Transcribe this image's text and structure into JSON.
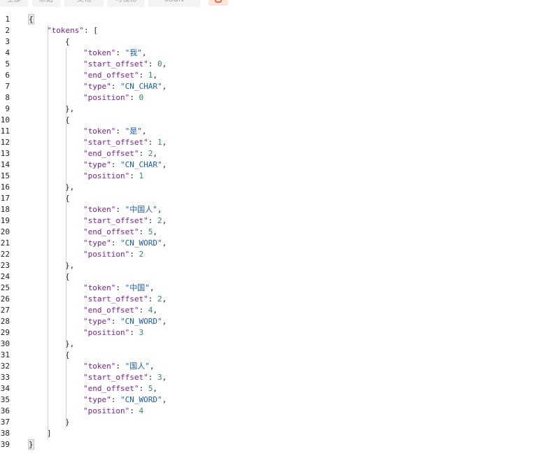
{
  "toolbar": {
    "items": [
      "全部",
      "原始",
      "美化",
      "可视化",
      "JSON"
    ],
    "icon": "share-icon"
  },
  "lines": [
    {
      "n": "1",
      "indent": 0,
      "parts": [
        [
          "p",
          "{"
        ]
      ]
    },
    {
      "n": "2",
      "indent": 1,
      "parts": [
        [
          "k",
          "\"tokens\""
        ],
        [
          "p",
          ": ["
        ]
      ]
    },
    {
      "n": "3",
      "indent": 2,
      "parts": [
        [
          "p",
          "{"
        ]
      ]
    },
    {
      "n": "4",
      "indent": 3,
      "parts": [
        [
          "k",
          "\"token\""
        ],
        [
          "p",
          ": "
        ],
        [
          "s",
          "\"我\""
        ],
        [
          "p",
          ","
        ]
      ]
    },
    {
      "n": "5",
      "indent": 3,
      "parts": [
        [
          "k",
          "\"start_offset\""
        ],
        [
          "p",
          ": "
        ],
        [
          "n",
          "0"
        ],
        [
          "p",
          ","
        ]
      ]
    },
    {
      "n": "6",
      "indent": 3,
      "parts": [
        [
          "k",
          "\"end_offset\""
        ],
        [
          "p",
          ": "
        ],
        [
          "n",
          "1"
        ],
        [
          "p",
          ","
        ]
      ]
    },
    {
      "n": "7",
      "indent": 3,
      "parts": [
        [
          "k",
          "\"type\""
        ],
        [
          "p",
          ": "
        ],
        [
          "s",
          "\"CN_CHAR\""
        ],
        [
          "p",
          ","
        ]
      ]
    },
    {
      "n": "8",
      "indent": 3,
      "parts": [
        [
          "k",
          "\"position\""
        ],
        [
          "p",
          ": "
        ],
        [
          "n",
          "0"
        ]
      ]
    },
    {
      "n": "9",
      "indent": 2,
      "parts": [
        [
          "p",
          "},"
        ]
      ]
    },
    {
      "n": "10",
      "indent": 2,
      "parts": [
        [
          "p",
          "{"
        ]
      ]
    },
    {
      "n": "11",
      "indent": 3,
      "parts": [
        [
          "k",
          "\"token\""
        ],
        [
          "p",
          ": "
        ],
        [
          "s",
          "\"是\""
        ],
        [
          "p",
          ","
        ]
      ]
    },
    {
      "n": "12",
      "indent": 3,
      "parts": [
        [
          "k",
          "\"start_offset\""
        ],
        [
          "p",
          ": "
        ],
        [
          "n",
          "1"
        ],
        [
          "p",
          ","
        ]
      ]
    },
    {
      "n": "13",
      "indent": 3,
      "parts": [
        [
          "k",
          "\"end_offset\""
        ],
        [
          "p",
          ": "
        ],
        [
          "n",
          "2"
        ],
        [
          "p",
          ","
        ]
      ]
    },
    {
      "n": "14",
      "indent": 3,
      "parts": [
        [
          "k",
          "\"type\""
        ],
        [
          "p",
          ": "
        ],
        [
          "s",
          "\"CN_CHAR\""
        ],
        [
          "p",
          ","
        ]
      ]
    },
    {
      "n": "15",
      "indent": 3,
      "parts": [
        [
          "k",
          "\"position\""
        ],
        [
          "p",
          ": "
        ],
        [
          "n",
          "1"
        ]
      ]
    },
    {
      "n": "16",
      "indent": 2,
      "parts": [
        [
          "p",
          "},"
        ]
      ]
    },
    {
      "n": "17",
      "indent": 2,
      "parts": [
        [
          "p",
          "{"
        ]
      ]
    },
    {
      "n": "18",
      "indent": 3,
      "parts": [
        [
          "k",
          "\"token\""
        ],
        [
          "p",
          ": "
        ],
        [
          "s",
          "\"中国人\""
        ],
        [
          "p",
          ","
        ]
      ]
    },
    {
      "n": "19",
      "indent": 3,
      "parts": [
        [
          "k",
          "\"start_offset\""
        ],
        [
          "p",
          ": "
        ],
        [
          "n",
          "2"
        ],
        [
          "p",
          ","
        ]
      ]
    },
    {
      "n": "20",
      "indent": 3,
      "parts": [
        [
          "k",
          "\"end_offset\""
        ],
        [
          "p",
          ": "
        ],
        [
          "n",
          "5"
        ],
        [
          "p",
          ","
        ]
      ]
    },
    {
      "n": "21",
      "indent": 3,
      "parts": [
        [
          "k",
          "\"type\""
        ],
        [
          "p",
          ": "
        ],
        [
          "s",
          "\"CN_WORD\""
        ],
        [
          "p",
          ","
        ]
      ]
    },
    {
      "n": "22",
      "indent": 3,
      "parts": [
        [
          "k",
          "\"position\""
        ],
        [
          "p",
          ": "
        ],
        [
          "n",
          "2"
        ]
      ]
    },
    {
      "n": "23",
      "indent": 2,
      "parts": [
        [
          "p",
          "},"
        ]
      ]
    },
    {
      "n": "24",
      "indent": 2,
      "parts": [
        [
          "p",
          "{"
        ]
      ]
    },
    {
      "n": "25",
      "indent": 3,
      "parts": [
        [
          "k",
          "\"token\""
        ],
        [
          "p",
          ": "
        ],
        [
          "s",
          "\"中国\""
        ],
        [
          "p",
          ","
        ]
      ]
    },
    {
      "n": "26",
      "indent": 3,
      "parts": [
        [
          "k",
          "\"start_offset\""
        ],
        [
          "p",
          ": "
        ],
        [
          "n",
          "2"
        ],
        [
          "p",
          ","
        ]
      ]
    },
    {
      "n": "27",
      "indent": 3,
      "parts": [
        [
          "k",
          "\"end_offset\""
        ],
        [
          "p",
          ": "
        ],
        [
          "n",
          "4"
        ],
        [
          "p",
          ","
        ]
      ]
    },
    {
      "n": "28",
      "indent": 3,
      "parts": [
        [
          "k",
          "\"type\""
        ],
        [
          "p",
          ": "
        ],
        [
          "s",
          "\"CN_WORD\""
        ],
        [
          "p",
          ","
        ]
      ]
    },
    {
      "n": "29",
      "indent": 3,
      "parts": [
        [
          "k",
          "\"position\""
        ],
        [
          "p",
          ": "
        ],
        [
          "n",
          "3"
        ]
      ]
    },
    {
      "n": "30",
      "indent": 2,
      "parts": [
        [
          "p",
          "},"
        ]
      ]
    },
    {
      "n": "31",
      "indent": 2,
      "parts": [
        [
          "p",
          "{"
        ]
      ]
    },
    {
      "n": "32",
      "indent": 3,
      "parts": [
        [
          "k",
          "\"token\""
        ],
        [
          "p",
          ": "
        ],
        [
          "s",
          "\"国人\""
        ],
        [
          "p",
          ","
        ]
      ]
    },
    {
      "n": "33",
      "indent": 3,
      "parts": [
        [
          "k",
          "\"start_offset\""
        ],
        [
          "p",
          ": "
        ],
        [
          "n",
          "3"
        ],
        [
          "p",
          ","
        ]
      ]
    },
    {
      "n": "34",
      "indent": 3,
      "parts": [
        [
          "k",
          "\"end_offset\""
        ],
        [
          "p",
          ": "
        ],
        [
          "n",
          "5"
        ],
        [
          "p",
          ","
        ]
      ]
    },
    {
      "n": "35",
      "indent": 3,
      "parts": [
        [
          "k",
          "\"type\""
        ],
        [
          "p",
          ": "
        ],
        [
          "s",
          "\"CN_WORD\""
        ],
        [
          "p",
          ","
        ]
      ]
    },
    {
      "n": "36",
      "indent": 3,
      "parts": [
        [
          "k",
          "\"position\""
        ],
        [
          "p",
          ": "
        ],
        [
          "n",
          "4"
        ]
      ]
    },
    {
      "n": "37",
      "indent": 2,
      "parts": [
        [
          "p",
          "}"
        ]
      ]
    },
    {
      "n": "38",
      "indent": 1,
      "parts": [
        [
          "p",
          "]"
        ]
      ]
    },
    {
      "n": "39",
      "indent": 0,
      "parts": [
        [
          "p",
          "}"
        ]
      ]
    }
  ]
}
